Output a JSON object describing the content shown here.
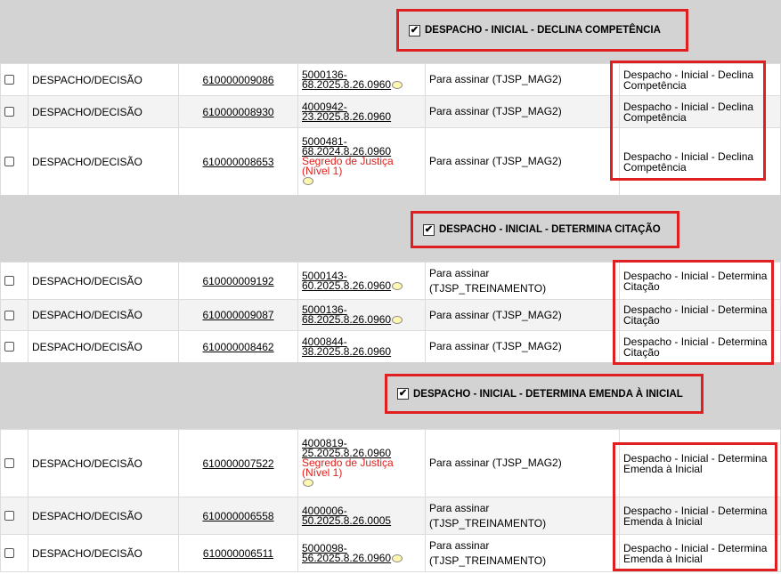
{
  "groups": [
    {
      "title": "DESPACHO - INICIAL - DECLINA COMPETÊNCIA",
      "rows": [
        {
          "tipo": "DESPACHO/DECISÃO",
          "doc": "610000009086",
          "proc1": "5000136-",
          "proc2": "68.2025.8.26.0960",
          "sigilo": "",
          "nivel": "",
          "status": "Para assinar (TJSP_MAG2)",
          "status2": "",
          "modelo": "Despacho - Inicial - Declina Competência",
          "bubble": true
        },
        {
          "tipo": "DESPACHO/DECISÃO",
          "doc": "610000008930",
          "proc1": "4000942-",
          "proc2": "23.2025.8.26.0960",
          "sigilo": "",
          "nivel": "",
          "status": "Para assinar (TJSP_MAG2)",
          "status2": "",
          "modelo": "Despacho - Inicial - Declina Competência",
          "bubble": false
        },
        {
          "tipo": "DESPACHO/DECISÃO",
          "doc": "610000008653",
          "proc1": "5000481-",
          "proc2": "68.2024.8.26.0960",
          "sigilo": "Segredo de Justiça",
          "nivel": "(Nível 1)",
          "status": "Para assinar (TJSP_MAG2)",
          "status2": "",
          "modelo": "Despacho - Inicial - Declina Competência",
          "bubble": true
        }
      ]
    },
    {
      "title": "DESPACHO - INICIAL - DETERMINA CITAÇÃO",
      "rows": [
        {
          "tipo": "DESPACHO/DECISÃO",
          "doc": "610000009192",
          "proc1": "5000143-",
          "proc2": "60.2025.8.26.0960",
          "sigilo": "",
          "nivel": "",
          "status": "Para assinar",
          "status2": "(TJSP_TREINAMENTO)",
          "modelo": "Despacho - Inicial - Determina Citação",
          "bubble": true
        },
        {
          "tipo": "DESPACHO/DECISÃO",
          "doc": "610000009087",
          "proc1": "5000136-",
          "proc2": "68.2025.8.26.0960",
          "sigilo": "",
          "nivel": "",
          "status": "Para assinar (TJSP_MAG2)",
          "status2": "",
          "modelo": "Despacho - Inicial - Determina Citação",
          "bubble": true
        },
        {
          "tipo": "DESPACHO/DECISÃO",
          "doc": "610000008462",
          "proc1": "4000844-",
          "proc2": "38.2025.8.26.0960",
          "sigilo": "",
          "nivel": "",
          "status": "Para assinar (TJSP_MAG2)",
          "status2": "",
          "modelo": "Despacho - Inicial - Determina Citação",
          "bubble": false
        }
      ]
    },
    {
      "title": "DESPACHO - INICIAL - DETERMINA EMENDA À INICIAL",
      "rows": [
        {
          "tipo": "DESPACHO/DECISÃO",
          "doc": "610000007522",
          "proc1": "4000819-",
          "proc2": "25.2025.8.26.0960",
          "sigilo": "Segredo de Justiça",
          "nivel": "(Nível 1)",
          "status": "Para assinar (TJSP_MAG2)",
          "status2": "",
          "modelo": "Despacho - Inicial - Determina Emenda à Inicial",
          "bubble": true
        },
        {
          "tipo": "DESPACHO/DECISÃO",
          "doc": "610000006558",
          "proc1": "4000006-",
          "proc2": "50.2025.8.26.0005",
          "sigilo": "",
          "nivel": "",
          "status": "Para assinar",
          "status2": "(TJSP_TREINAMENTO)",
          "modelo": "Despacho - Inicial - Determina Emenda à Inicial",
          "bubble": false
        },
        {
          "tipo": "DESPACHO/DECISÃO",
          "doc": "610000006511",
          "proc1": "5000098-",
          "proc2": "56.2025.8.26.0960",
          "sigilo": "",
          "nivel": "",
          "status": "Para assinar",
          "status2": "(TJSP_TREINAMENTO)",
          "modelo": "Despacho - Inicial - Determina Emenda à Inicial",
          "bubble": true
        }
      ]
    }
  ],
  "icons": {
    "checkbox": "checkbox-icon",
    "bubble": "comment-bubble-icon",
    "checkmark": "✔"
  },
  "colors": {
    "highlight": "#e02020",
    "header_bg": "#d3d3d3",
    "sigilo": "#e0201c"
  }
}
